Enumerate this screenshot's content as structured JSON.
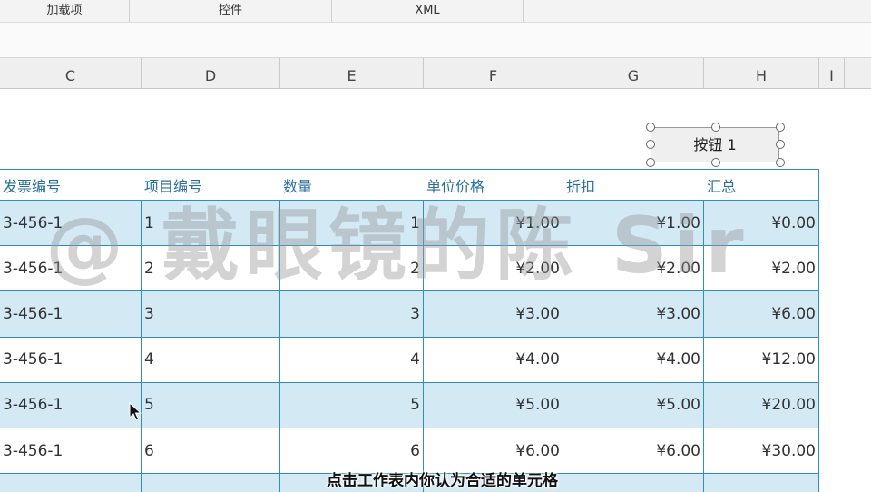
{
  "ribbon": {
    "groups": [
      "加载项",
      "控件",
      "XML"
    ]
  },
  "columns": [
    "C",
    "D",
    "E",
    "F",
    "G",
    "H",
    "I"
  ],
  "button": {
    "label": "按钮 1"
  },
  "table": {
    "headers": [
      "发票编号",
      "项目编号",
      "数量",
      "单位价格",
      "折扣",
      "汇总"
    ],
    "rows": [
      [
        "3-456-1",
        "1",
        "1",
        "¥1.00",
        "¥1.00",
        "¥0.00"
      ],
      [
        "3-456-1",
        "2",
        "2",
        "¥2.00",
        "¥2.00",
        "¥2.00"
      ],
      [
        "3-456-1",
        "3",
        "3",
        "¥3.00",
        "¥3.00",
        "¥6.00"
      ],
      [
        "3-456-1",
        "4",
        "4",
        "¥4.00",
        "¥4.00",
        "¥12.00"
      ],
      [
        "3-456-1",
        "5",
        "5",
        "¥5.00",
        "¥5.00",
        "¥20.00"
      ],
      [
        "3-456-1",
        "6",
        "6",
        "¥6.00",
        "¥6.00",
        "¥30.00"
      ]
    ]
  },
  "watermark": "@ 戴眼镜的陈 Sir",
  "subtitle": "点击工作表内你认为合适的单元格",
  "colors": {
    "table_border": "#2f8fc4",
    "band_fill": "#d3e9f4",
    "header_text": "#2b6f9e"
  }
}
